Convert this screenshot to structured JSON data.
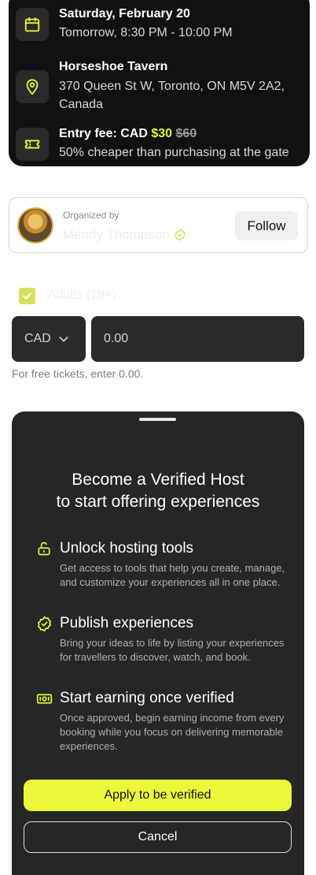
{
  "event": {
    "date_title": "Saturday, February 20",
    "date_sub": "Tomorrow, 8:30 PM - 10:00 PM",
    "venue_title": "Horseshoe Tavern",
    "venue_address_line1": "370 Queen St W, Toronto, ON M5V 2A2,",
    "venue_address_line2": "Canada",
    "fee_prefix": "Entry fee: CAD ",
    "fee_price": "$30",
    "fee_old_price": "$60",
    "fee_sub": "50% cheaper than purchasing at the gate",
    "icons": [
      "calendar-icon",
      "location-pin-icon",
      "ticket-icon"
    ]
  },
  "organizer": {
    "label": "Organized by",
    "name": "Mendy Thompson",
    "follow_label": "Follow"
  },
  "tickets": {
    "adults_label": "Adults (18+)",
    "adults_checked": true,
    "currency": "CAD",
    "amount_value": "0.00",
    "helper": "For free tickets, enter 0.00."
  },
  "sheet": {
    "title": "Become a Verified Host\nto start offering experiences",
    "features": [
      {
        "icon": "unlock-icon",
        "title": "Unlock hosting tools",
        "desc": "Get access to tools that help you create, manage, and customize your experiences all in one place."
      },
      {
        "icon": "verified-check-icon",
        "title": "Publish experiences",
        "desc": "Bring your ideas to life by listing your experiences for travellers to discover, watch, and book."
      },
      {
        "icon": "money-icon",
        "title": "Start earning once verified",
        "desc": "Once approved, begin earning income from every booking while you focus on delivering memorable experiences."
      }
    ],
    "apply_label": "Apply to be verified",
    "cancel_label": "Cancel"
  },
  "colors": {
    "accent": "#EAF73A",
    "dark_card": "#111111",
    "sheet_bg": "#262626",
    "input_bg": "#2A2A2A"
  }
}
